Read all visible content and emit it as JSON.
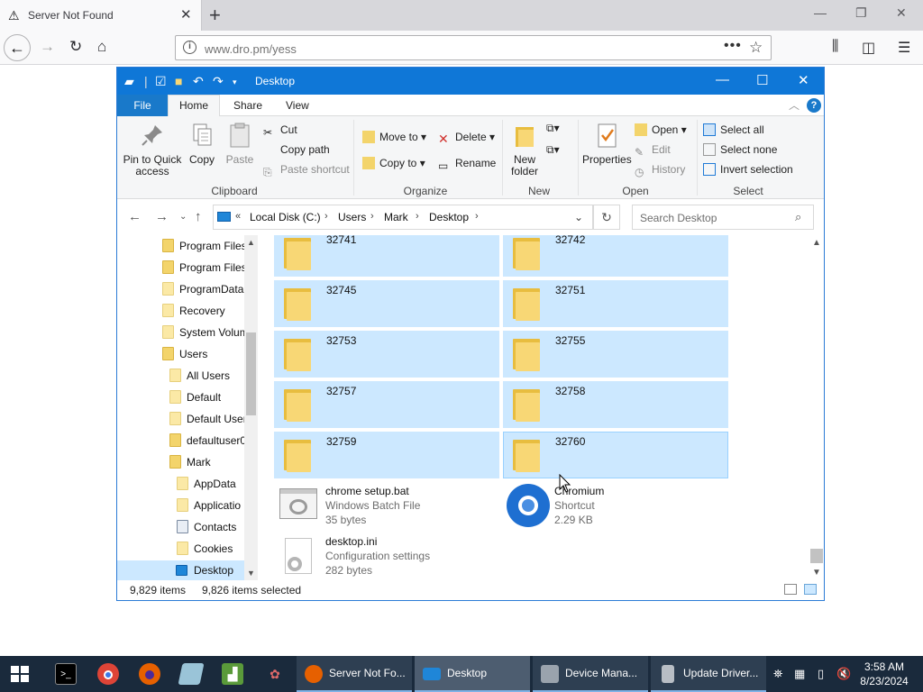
{
  "browser": {
    "tab_title": "Server Not Found",
    "url": "www.dro.pm/yess"
  },
  "explorer": {
    "title": "Desktop",
    "ribbon_tabs": [
      "File",
      "Home",
      "Share",
      "View"
    ],
    "clipboard": {
      "pin_label": "Pin to Quick access",
      "copy_label": "Copy",
      "paste_label": "Paste",
      "cut_label": "Cut",
      "copy_path_label": "Copy path",
      "paste_shortcut_label": "Paste shortcut",
      "group_label": "Clipboard"
    },
    "organize": {
      "move_to_label": "Move to",
      "copy_to_label": "Copy to",
      "delete_label": "Delete",
      "rename_label": "Rename",
      "group_label": "Organize"
    },
    "new": {
      "new_folder_label": "New folder",
      "group_label": "New"
    },
    "open": {
      "properties_label": "Properties",
      "open_label": "Open",
      "edit_label": "Edit",
      "history_label": "History",
      "group_label": "Open"
    },
    "select": {
      "select_all_label": "Select all",
      "select_none_label": "Select none",
      "invert_label": "Invert selection",
      "group_label": "Select"
    },
    "breadcrumb": [
      "Local Disk (C:)",
      "Users",
      "Mark",
      "Desktop"
    ],
    "search_placeholder": "Search Desktop",
    "nav_items": [
      {
        "label": "Program Files"
      },
      {
        "label": "Program Files"
      },
      {
        "label": "ProgramData"
      },
      {
        "label": "Recovery"
      },
      {
        "label": "System Volum"
      },
      {
        "label": "Users"
      },
      {
        "label": "All Users"
      },
      {
        "label": "Default"
      },
      {
        "label": "Default User"
      },
      {
        "label": "defaultuser0"
      },
      {
        "label": "Mark"
      },
      {
        "label": "AppData"
      },
      {
        "label": "Applicatio"
      },
      {
        "label": "Contacts"
      },
      {
        "label": "Cookies"
      },
      {
        "label": "Desktop"
      }
    ],
    "folders": [
      "32741",
      "32742",
      "32745",
      "32751",
      "32753",
      "32755",
      "32757",
      "32758",
      "32759",
      "32760"
    ],
    "files": [
      {
        "name": "chrome setup.bat",
        "type": "Windows Batch File",
        "size": "35 bytes"
      },
      {
        "name": "Chromium",
        "type": "Shortcut",
        "size": "2.29 KB"
      },
      {
        "name": "desktop.ini",
        "type": "Configuration settings",
        "size": "282 bytes"
      }
    ],
    "status": {
      "items": "9,829 items",
      "selected": "9,826 items selected"
    }
  },
  "taskbar": {
    "tasks": [
      "Server Not Fo...",
      "Desktop",
      "Device Mana...",
      "Update Driver..."
    ],
    "time": "3:58 AM",
    "date": "8/23/2024"
  }
}
